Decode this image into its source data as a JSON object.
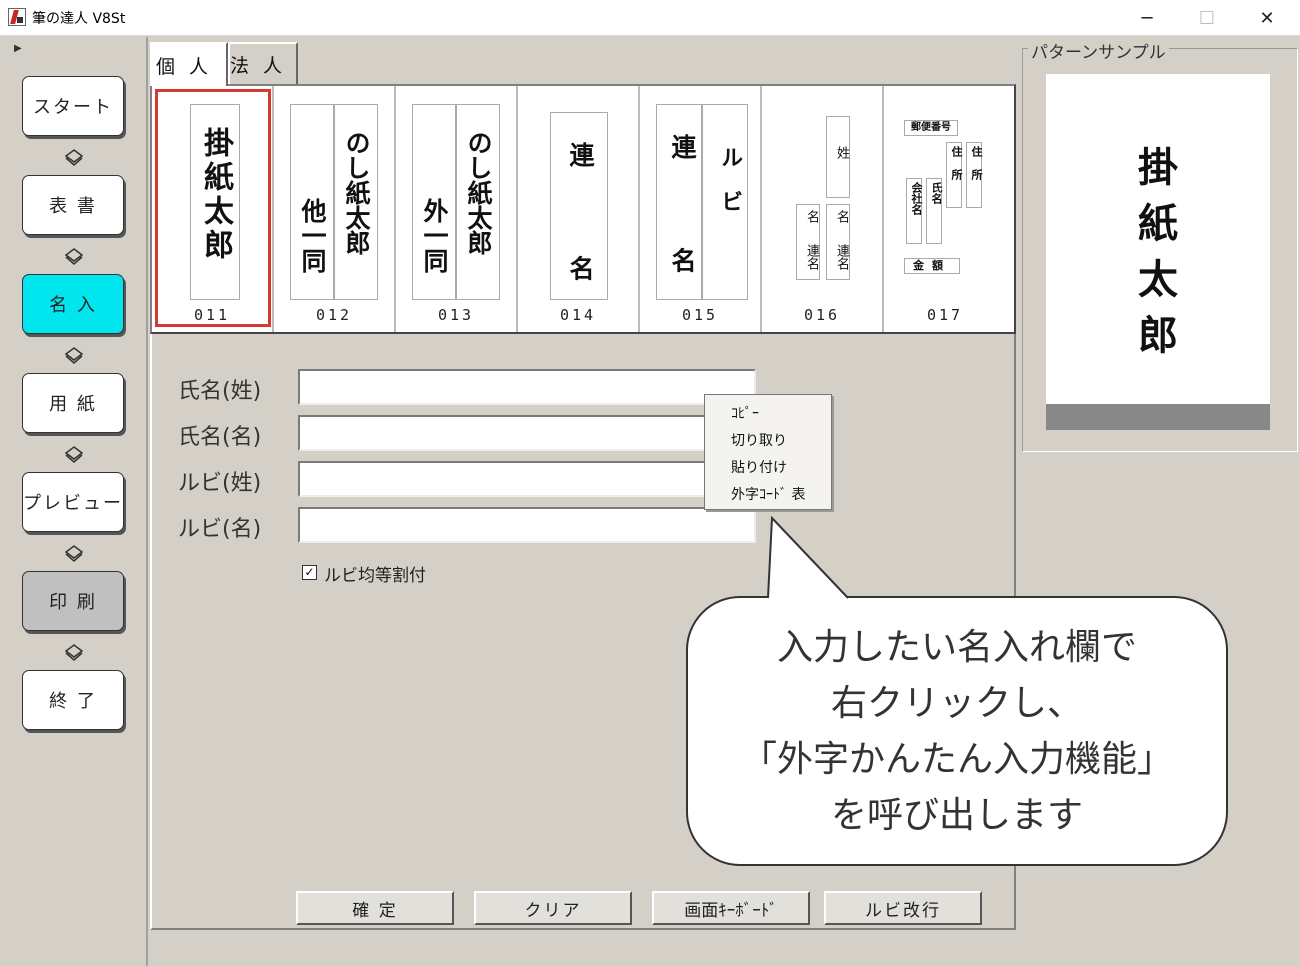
{
  "window": {
    "title": "筆の達人 V8St",
    "minimize": "─",
    "maximize": "☐",
    "close": "✕"
  },
  "nav": {
    "collapse": "▶",
    "items": [
      "スタート",
      "表 書",
      "名 入",
      "用 紙",
      "プレビュー",
      "印 刷",
      "終 了"
    ],
    "active_index": 2,
    "active_color": "#00e5ee"
  },
  "tabs": [
    "個人",
    "法人"
  ],
  "patterns": [
    {
      "code": "011",
      "cols": [
        "掛紙太郎"
      ]
    },
    {
      "code": "012",
      "cols": [
        "のし紙太郎",
        "他一同"
      ]
    },
    {
      "code": "013",
      "cols": [
        "のし紙太郎",
        "外一同"
      ]
    },
    {
      "code": "014",
      "cols": [
        "連 名"
      ]
    },
    {
      "code": "015",
      "cols": [
        "ルビ",
        "連 名"
      ]
    },
    {
      "code": "016",
      "cols": [
        "姓",
        "名",
        "連名",
        "名",
        "連名"
      ]
    },
    {
      "code": "017",
      "cols": [
        "郵便番号",
        "住所",
        "住所",
        "氏名",
        "会社名",
        "金額"
      ]
    }
  ],
  "form": {
    "fields": [
      {
        "label": "氏名(姓)",
        "value": ""
      },
      {
        "label": "氏名(名)",
        "value": ""
      },
      {
        "label": "ルビ(姓)",
        "value": ""
      },
      {
        "label": "ルビ(名)",
        "value": ""
      }
    ],
    "ruby_checkbox": {
      "checked": true,
      "mark": "✓",
      "label": "ルビ均等割付"
    },
    "buttons": [
      "確 定",
      "クリア",
      "画面ｷｰﾎﾞｰﾄﾞ",
      "ルビ改行"
    ]
  },
  "context_menu": [
    "ｺﾋﾟｰ",
    "切り取り",
    "貼り付け",
    "外字ｺｰﾄﾞ 表"
  ],
  "sample": {
    "label": "パターンサンプル",
    "chars": [
      "掛",
      "紙",
      "太",
      "郎"
    ]
  },
  "callout": {
    "lines": [
      "入力したい名入れ欄で",
      "右クリックし、",
      "「外字かんたん入力機能」",
      "を呼び出します"
    ]
  }
}
